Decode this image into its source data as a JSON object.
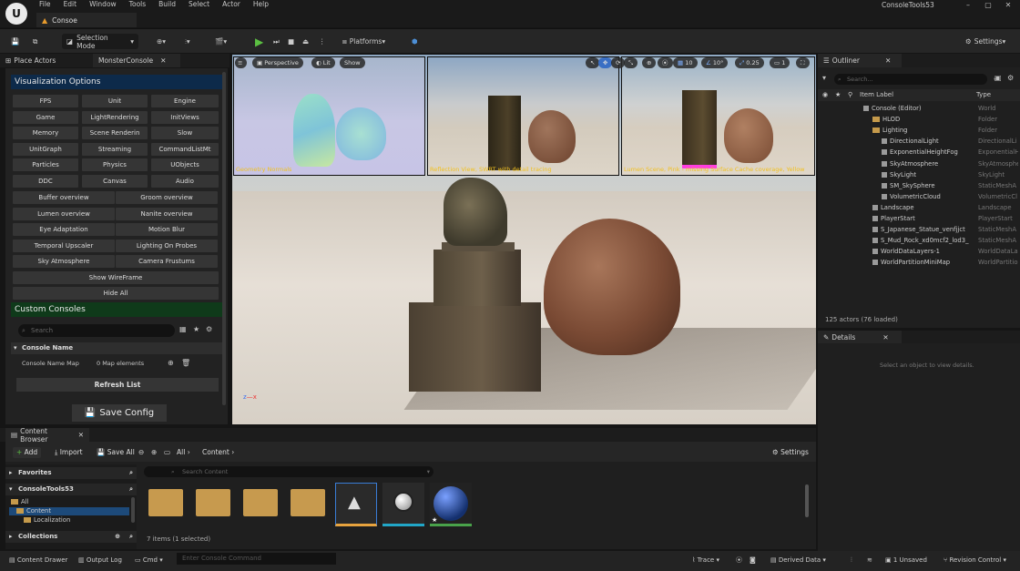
{
  "menubar": [
    "File",
    "Edit",
    "Window",
    "Tools",
    "Build",
    "Select",
    "Actor",
    "Help"
  ],
  "doc_tab": "Consoe",
  "project_name": "ConsoleTools53",
  "toolbar": {
    "mode": "Selection Mode",
    "platforms": "Platforms",
    "settings": "Settings"
  },
  "left_tabs": {
    "place_actors": "Place Actors",
    "monster_console": "MonsterConsole"
  },
  "visualization": {
    "header": "Visualization Options",
    "buttons": [
      "FPS",
      "Unit",
      "Engine",
      "Game",
      "LightRendering",
      "InitViews",
      "Memory",
      "Scene Renderin",
      "Slow",
      "UnitGraph",
      "Streaming",
      "CommandListMt",
      "Particles",
      "Physics",
      "UObjects",
      "DDC",
      "Canvas",
      "Audio",
      "Buffer overview",
      "Groom overview",
      "Lumen overview",
      "Nanite overview",
      "Eye Adaptation",
      "Motion Blur",
      "Temporal Upscaler",
      "Lighting On Probes",
      "Sky Atmosphere",
      "Camera Frustums"
    ],
    "show_wireframe": "Show WireFrame",
    "hide_all": "Hide All"
  },
  "custom_consoles": {
    "header": "Custom Consoles",
    "search_placeholder": "Search",
    "column": "Console Name",
    "row_name": "Console Name Map",
    "row_value": "0 Map elements",
    "refresh": "Refresh List",
    "save": "Save Config"
  },
  "viewport": {
    "perspective": "Perspective",
    "lit": "Lit",
    "show": "Show",
    "grid_size": "10",
    "angle": "10°",
    "scale": "0.25",
    "camera_speed": "1",
    "captions": [
      "Geometry Normals",
      "Reflection View, SWRT with detail tracing",
      "Lumen Scene, Pink - missing Surface Cache coverage, Yellow"
    ]
  },
  "outliner": {
    "tab": "Outliner",
    "search_placeholder": "Search...",
    "col_label": "Item Label",
    "col_type": "Type",
    "rows": [
      {
        "label": "Console (Editor)",
        "type": "World",
        "indent": 0
      },
      {
        "label": "HLOD",
        "type": "Folder",
        "indent": 1
      },
      {
        "label": "Lighting",
        "type": "Folder",
        "indent": 1
      },
      {
        "label": "DirectionalLight",
        "type": "DirectionalLi",
        "indent": 2
      },
      {
        "label": "ExponentialHeightFog",
        "type": "ExponentialH",
        "indent": 2
      },
      {
        "label": "SkyAtmosphere",
        "type": "SkyAtmosphe",
        "indent": 2
      },
      {
        "label": "SkyLight",
        "type": "SkyLight",
        "indent": 2
      },
      {
        "label": "SM_SkySphere",
        "type": "StaticMeshA",
        "indent": 2
      },
      {
        "label": "VolumetricCloud",
        "type": "VolumetricCl",
        "indent": 2
      },
      {
        "label": "Landscape",
        "type": "Landscape",
        "indent": 1
      },
      {
        "label": "PlayerStart",
        "type": "PlayerStart",
        "indent": 1
      },
      {
        "label": "S_Japanese_Statue_venfjjct",
        "type": "StaticMeshA",
        "indent": 1
      },
      {
        "label": "S_Mud_Rock_xd0mcf2_lod3_",
        "type": "StaticMeshA",
        "indent": 1
      },
      {
        "label": "WorldDataLayers-1",
        "type": "WorldDataLa",
        "indent": 1
      },
      {
        "label": "WorldPartitionMiniMap",
        "type": "WorldPartitio",
        "indent": 1
      }
    ],
    "actor_count": "125 actors (76 loaded)"
  },
  "details": {
    "tab": "Details",
    "empty": "Select an object to view details."
  },
  "content_browser": {
    "tab": "Content Browser",
    "add": "Add",
    "import": "Import",
    "save_all": "Save All",
    "path_all": "All",
    "path_content": "Content",
    "settings": "Settings",
    "favorites": "Favorites",
    "project": "ConsoleTools53",
    "tree_all": "All",
    "tree_content": "Content",
    "tree_localization": "Localization",
    "collections": "Collections",
    "search_placeholder": "Search Content",
    "items_text": "7 items (1 selected)"
  },
  "statusbar": {
    "content_drawer": "Content Drawer",
    "output_log": "Output Log",
    "cmd": "Cmd",
    "cmd_placeholder": "Enter Console Command",
    "trace": "Trace",
    "derived_data": "Derived Data",
    "unsaved": "1 Unsaved",
    "revision": "Revision Control"
  }
}
